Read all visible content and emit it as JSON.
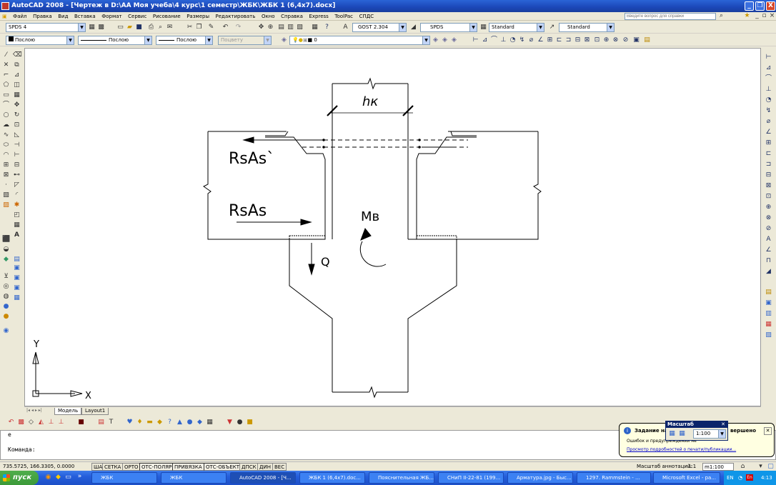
{
  "window": {
    "title": "AutoCAD 2008 - [Чертеж в D:\\АА Моя учеба\\4 курс\\1 семестр\\ЖБК\\ЖБК 1 (6,4x7).docx]",
    "minimize": "_",
    "restore": "❐",
    "close": "X"
  },
  "menu": {
    "items": [
      "Файл",
      "Правка",
      "Вид",
      "Вставка",
      "Формат",
      "Сервис",
      "Рисование",
      "Размеры",
      "Редактировать",
      "Окно",
      "Справка",
      "Express",
      "ToolPac",
      "СПДС"
    ],
    "help_placeholder": "Введите вопрос для справки"
  },
  "toolbar1": {
    "workspace": "SPDS 4",
    "text_style": "GOST 2.304",
    "dim_style": "SPDS",
    "table_style": "Standard",
    "mleader_style": "Standard"
  },
  "toolbar2": {
    "color": "Послою",
    "linetype": "Послою",
    "lineweight": "Послою",
    "plotstyle": "Поцвету",
    "layer": "0"
  },
  "drawing": {
    "labels": {
      "hk": "hк",
      "rsas_prime": "RsAs`",
      "rsas": "RsAs",
      "mb": "Mв",
      "q": "Q"
    },
    "ucs": {
      "x": "X",
      "y": "Y"
    }
  },
  "tabs": {
    "nav": "|◂ ◂ ▸ ▸|",
    "model": "Модель",
    "layout1": "Layout1"
  },
  "command": {
    "history": "е",
    "prompt": "Команда:"
  },
  "status": {
    "coords": "735.5725, 166.3305, 0.0000",
    "buttons": [
      "ШАГ",
      "СЕТКА",
      "ОРТО",
      "ОТС-ПОЛЯР",
      "ПРИВЯЗКА",
      "ОТС-ОБЪЕКТ",
      "ДПСК",
      "ДИН",
      "ВЕС"
    ],
    "annotation_scale_label": "Масштаб аннотаций:",
    "annotation_scale_value": "1:1",
    "scale": "m1:100"
  },
  "balloon": {
    "title_left": "Задание на",
    "title_right": "вершено",
    "line1": "Ошибок и предупреждений не",
    "link": "Просмотр подробностей о печати/публикации..."
  },
  "scale_popup": {
    "title": "Масштаб",
    "value": "1:100"
  },
  "taskbar": {
    "start": "пуск",
    "items": [
      "ЖБК",
      "ЖБК",
      "AutoCAD 2008 - [Ч...",
      "ЖБК 1 (6,4x7).doc...",
      "Пояснительная ЖБ...",
      "СНиП II-22-81 (199...",
      "Арматура.jpg - Быс...",
      "1297. Rammstein - ...",
      "Microsoft Excel - ра..."
    ],
    "lang": "EN",
    "time": "4:13"
  },
  "colors": {
    "title_blue": "#2b64d6",
    "taskbar_blue": "#245edb",
    "start_green": "#3c9a39"
  }
}
